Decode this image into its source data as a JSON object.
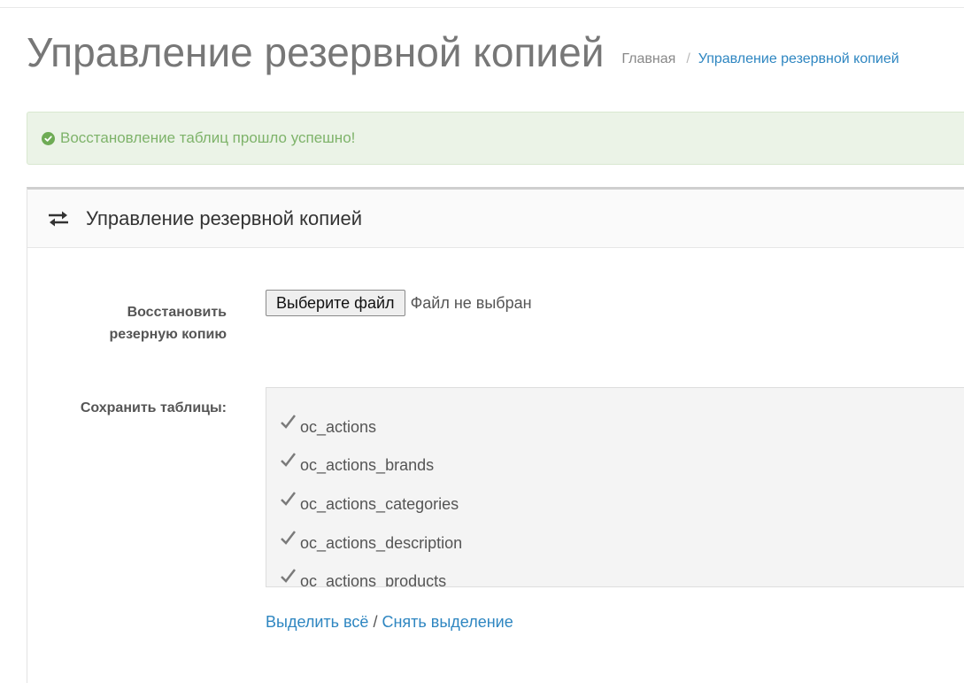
{
  "header": {
    "title": "Управление резервной копией",
    "breadcrumb": [
      {
        "label": "Главная"
      },
      {
        "label": "Управление резервной копией"
      }
    ],
    "breadcrumb_separator": "/"
  },
  "alert": {
    "icon": "check-circle-icon",
    "message": "Восстановление таблиц прошло успешно!",
    "color": "#7eb36a"
  },
  "panel": {
    "icon": "exchange-icon",
    "title": "Управление резервной копией"
  },
  "form": {
    "restore_label": "Восстановить резерную копию",
    "file_button_label": "Выберите файл",
    "file_status": "Файл не выбран",
    "tables_label": "Сохранить таблицы:",
    "tables": [
      {
        "name": "oc_actions",
        "checked": true
      },
      {
        "name": "oc_actions_brands",
        "checked": true
      },
      {
        "name": "oc_actions_categories",
        "checked": true
      },
      {
        "name": "oc_actions_description",
        "checked": true
      },
      {
        "name": "oc_actions_products",
        "checked": true
      }
    ],
    "select_all_label": "Выделить всё",
    "links_separator": "/",
    "deselect_label": "Снять выделение"
  },
  "colors": {
    "link": "#2e86c1",
    "alert_background": "#ebf3e7"
  }
}
